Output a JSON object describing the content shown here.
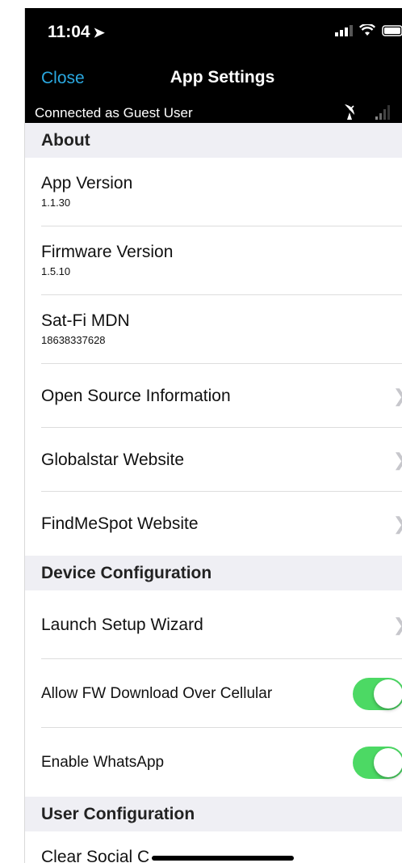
{
  "status_bar": {
    "time": "11:04",
    "location_icon": "location-arrow-icon",
    "icons": [
      "cellular-signal-icon",
      "wifi-icon",
      "battery-icon"
    ]
  },
  "nav": {
    "close_label": "Close",
    "title": "App Settings"
  },
  "connection": {
    "text": "Connected as Guest User",
    "icons": [
      "satellite-dish-icon",
      "signal-bars-icon"
    ]
  },
  "sections": {
    "about": {
      "header": "About",
      "app_version": {
        "label": "App Version",
        "value": "1.1.30"
      },
      "firmware_version": {
        "label": "Firmware Version",
        "value": "1.5.10"
      },
      "sat_fi_mdn": {
        "label": "Sat-Fi MDN",
        "value": "18638337628"
      },
      "open_source": "Open Source Information",
      "globalstar": "Globalstar Website",
      "findmespot": "FindMeSpot Website"
    },
    "device_configuration": {
      "header": "Device Configuration",
      "launch_wizard": "Launch Setup Wizard",
      "allow_fw_download": {
        "label": "Allow FW Download Over Cellular",
        "enabled": true
      },
      "enable_whatsapp": {
        "label": "Enable WhatsApp",
        "enabled": true
      }
    },
    "user_configuration": {
      "header": "User Configuration",
      "clear_social": "Clear Social C"
    }
  },
  "colors": {
    "accent": "#2aa8e0",
    "toggle_on": "#4cd964",
    "section_bg": "#efeff4",
    "topbar_bg": "#000000"
  }
}
